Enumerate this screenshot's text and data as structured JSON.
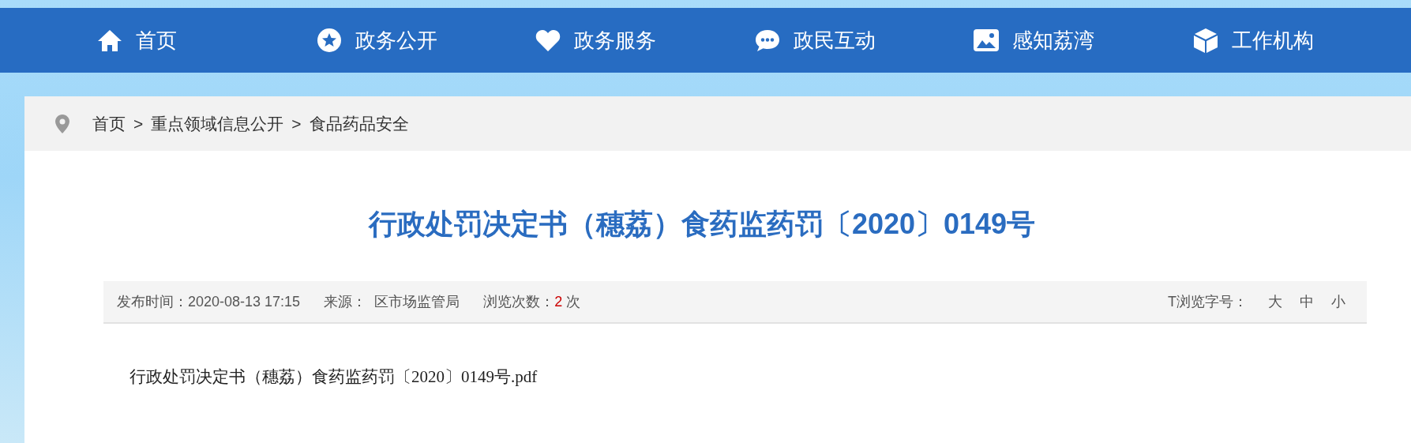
{
  "nav": [
    {
      "label": "首页"
    },
    {
      "label": "政务公开"
    },
    {
      "label": "政务服务"
    },
    {
      "label": "政民互动"
    },
    {
      "label": "感知荔湾"
    },
    {
      "label": "工作机构"
    }
  ],
  "breadcrumb": {
    "separator": ">",
    "items": [
      "首页",
      "重点领域信息公开",
      "食品药品安全"
    ]
  },
  "article": {
    "title": "行政处罚决定书（穗荔）食药监药罚〔2020〕0149号",
    "meta": {
      "date_label": "发布时间：",
      "date": "2020-08-13 17:15",
      "source_label": "来源：",
      "source": "区市场监管局",
      "views_label": "浏览次数：",
      "views": "2",
      "views_unit": "次",
      "font_size_label": "T浏览字号：",
      "font_sizes": [
        "大",
        "中",
        "小"
      ]
    },
    "attachment": "行政处罚决定书（穗荔）食药监药罚〔2020〕0149号.pdf"
  }
}
